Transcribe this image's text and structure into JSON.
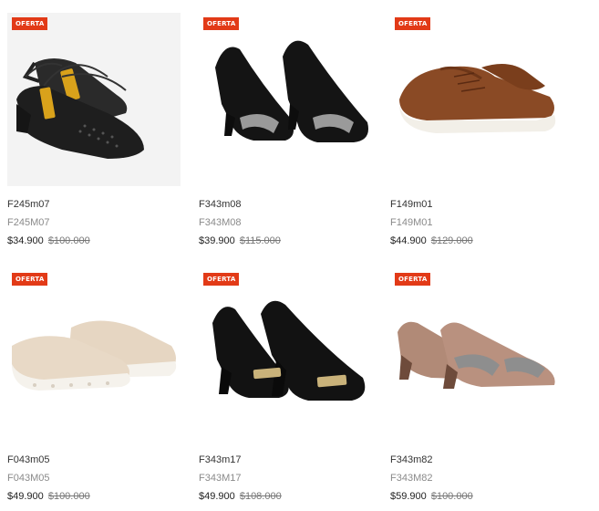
{
  "products": [
    {
      "badge": "OFERTA",
      "name": "F245m07",
      "sku": "F245M07",
      "price": "$34.900",
      "old_price": "$100.000",
      "image": "black-slingback-low-heel",
      "colors": {
        "main": "#1e1e1e",
        "accent": "#d9a21b"
      }
    },
    {
      "badge": "OFERTA",
      "name": "F343m08",
      "sku": "F343M08",
      "price": "$39.900",
      "old_price": "$115.000",
      "image": "black-pump-glitter-band",
      "colors": {
        "main": "#141414",
        "accent": "#9a9a9a"
      }
    },
    {
      "badge": "OFERTA",
      "name": "F149m01",
      "sku": "F149M01",
      "price": "$44.900",
      "old_price": "$129.000",
      "image": "brown-lace-up-sneaker",
      "colors": {
        "main": "#8a4a25",
        "accent": "#f2efe8"
      }
    },
    {
      "badge": "OFERTA",
      "name": "F043m05",
      "sku": "F043M05",
      "price": "$49.900",
      "old_price": "$100.000",
      "image": "beige-slip-on-sneaker",
      "colors": {
        "main": "#e8d9c6",
        "accent": "#f5f2ec"
      }
    },
    {
      "badge": "OFERTA",
      "name": "F343m17",
      "sku": "F343M17",
      "price": "$49.900",
      "old_price": "$108.000",
      "image": "black-pump-gold-buckle",
      "colors": {
        "main": "#121212",
        "accent": "#c9b27a"
      }
    },
    {
      "badge": "OFERTA",
      "name": "F343m82",
      "sku": "F343M82",
      "price": "$59.900",
      "old_price": "$100.000",
      "image": "nude-pump-glitter-band",
      "colors": {
        "main": "#b9917f",
        "accent": "#8e8e8e"
      }
    }
  ]
}
